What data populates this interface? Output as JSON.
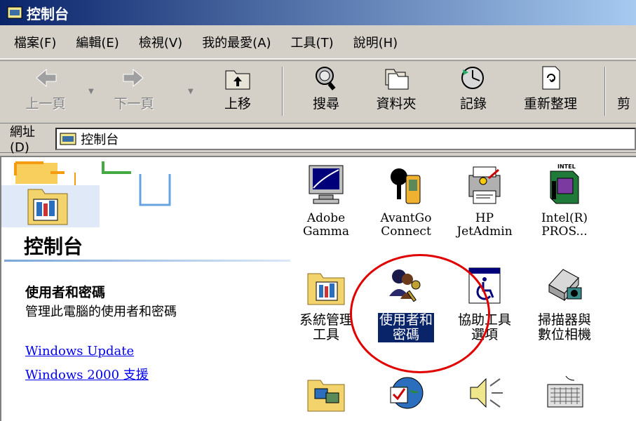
{
  "window": {
    "title": "控制台"
  },
  "menu": [
    "檔案(F)",
    "編輯(E)",
    "檢視(V)",
    "我的最愛(A)",
    "工具(T)",
    "說明(H)"
  ],
  "toolbar": {
    "back": "上一頁",
    "forward": "下一頁",
    "up": "上移",
    "search": "搜尋",
    "folders": "資料夾",
    "history": "記錄",
    "rearrange": "重新整理",
    "cut_off": "剪"
  },
  "address": {
    "label": "網址(D)",
    "value": "控制台"
  },
  "leftpane": {
    "title": "控制台",
    "selected_name": "使用者和密碼",
    "selected_desc": "管理此電腦的使用者和密碼",
    "links": [
      "Windows Update",
      "Windows 2000 支援"
    ]
  },
  "items": [
    {
      "label": "Adobe\nGamma",
      "icon": "monitor-gamma-icon"
    },
    {
      "label": "AvantGo\nConnect",
      "icon": "avantgo-icon"
    },
    {
      "label": "HP\nJetAdmin",
      "icon": "printer-icon"
    },
    {
      "label": "Intel(R)\nPROS...",
      "icon": "network-card-icon"
    },
    {
      "label": "系統管理\n工具",
      "icon": "admin-tools-folder-icon"
    },
    {
      "label": "使用者和\n密碼",
      "icon": "users-key-icon"
    },
    {
      "label": "協助工具\n選項",
      "icon": "accessibility-icon"
    },
    {
      "label": "掃描器與\n數位相機",
      "icon": "scanner-icon"
    },
    {
      "label": "",
      "icon": "network-folder-icon"
    },
    {
      "label": "",
      "icon": "globe-check-icon"
    },
    {
      "label": "",
      "icon": "speaker-icon"
    },
    {
      "label": "",
      "icon": "keyboard-icon"
    }
  ]
}
